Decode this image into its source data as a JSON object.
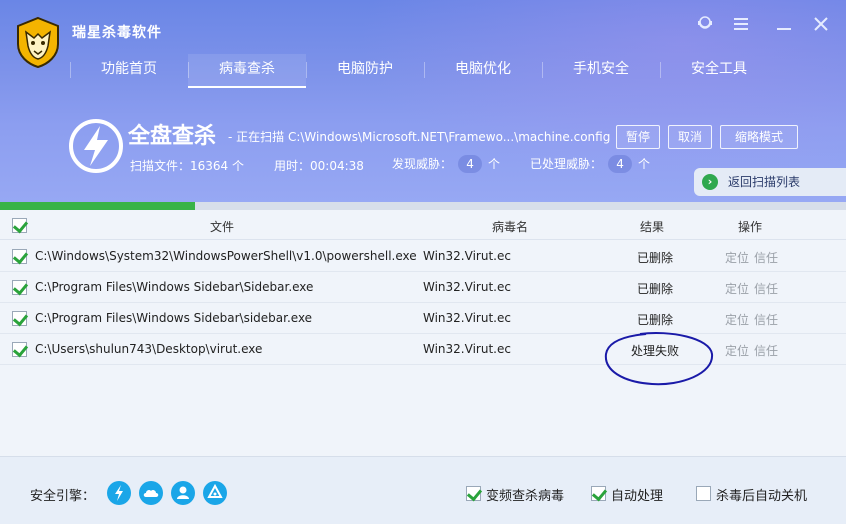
{
  "app": {
    "title": "瑞星杀毒软件"
  },
  "window": {
    "controls": [
      "user-icon",
      "menu-icon",
      "minimize-icon",
      "close-icon"
    ]
  },
  "tabs": [
    {
      "label": "功能首页"
    },
    {
      "label": "病毒查杀",
      "active": true
    },
    {
      "label": "电脑防护"
    },
    {
      "label": "电脑优化"
    },
    {
      "label": "手机安全"
    },
    {
      "label": "安全工具"
    }
  ],
  "scan": {
    "title": "全盘查杀",
    "status": "- 正在扫描 C:\\Windows\\Microsoft.NET\\Framewo...\\machine.config",
    "buttons": {
      "pause": "暂停",
      "cancel": "取消",
      "mini": "缩略模式"
    },
    "files_label": "扫描文件：",
    "files_value": "16364",
    "unit_ge": "个",
    "time_label": "用时：",
    "time_value": "00:04:38",
    "threat_label": "发现威胁：",
    "threat_value": "4",
    "handled_label": "已处理威胁：",
    "handled_value": "4",
    "return_label": "返回扫描列表",
    "progress_percent": 23
  },
  "table": {
    "headers": {
      "file": "文件",
      "virus": "病毒名",
      "result": "结果",
      "action": "操作"
    },
    "actions": {
      "locate": "定位",
      "trust": "信任"
    },
    "rows": [
      {
        "file": "C:\\Windows\\System32\\WindowsPowerShell\\v1.0\\powershell.exe",
        "virus": "Win32.Virut.ec",
        "result": "已删除"
      },
      {
        "file": "C:\\Program Files\\Windows Sidebar\\Sidebar.exe",
        "virus": "Win32.Virut.ec",
        "result": "已删除"
      },
      {
        "file": "C:\\Program Files\\Windows Sidebar\\sidebar.exe",
        "virus": "Win32.Virut.ec",
        "result": "已删除"
      },
      {
        "file": "C:\\Users\\shulun743\\Desktop\\virut.exe",
        "virus": "Win32.Virut.ec",
        "result": "处理失败"
      }
    ]
  },
  "footer": {
    "engine_label": "安全引擎：",
    "engines": [
      "lightning-icon",
      "cloud-icon",
      "user-icon",
      "drive-icon"
    ],
    "options": [
      {
        "label": "变频查杀病毒",
        "checked": true
      },
      {
        "label": "自动处理",
        "checked": true
      },
      {
        "label": "杀毒后自动关机",
        "checked": false
      }
    ]
  },
  "colors": {
    "header_top": "#6a86e6",
    "accent_green": "#38b347",
    "annotation": "#1a1aa8"
  }
}
